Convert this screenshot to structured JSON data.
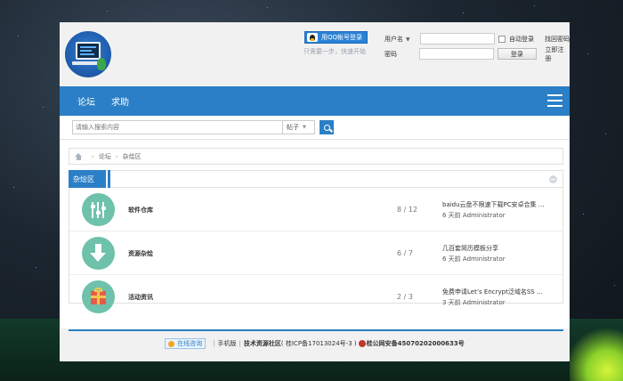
{
  "header": {
    "qq_login_label": "用QQ帐号登录",
    "qq_tip": "只需要一步，快速开始",
    "username_label": "用户名",
    "password_label": "密码",
    "auto_login_label": "自动登录",
    "find_password": "找回密码",
    "register": "立即注册",
    "login_button": "登录"
  },
  "nav": {
    "items": [
      "论坛",
      "求助"
    ]
  },
  "search": {
    "placeholder": "请输入搜索内容",
    "type": "帖子"
  },
  "breadcrumb": {
    "items": [
      "论坛",
      "杂烩区"
    ]
  },
  "board": {
    "title": "杂烩区",
    "forums": [
      {
        "name": "软件仓库",
        "count": "8 / 12",
        "last_title": "baidu云盘不限速下载PC安卓合集 ...",
        "last_meta": "6 天前 Administrator"
      },
      {
        "name": "资源杂烩",
        "count": "6 / 7",
        "last_title": "几百套简历模板分享",
        "last_meta": "6 天前 Administrator"
      },
      {
        "name": "活动资讯",
        "count": "2 / 3",
        "last_title": "免费申请Let’s Encrypt泛域名SS ...",
        "last_meta": "3 天前 Administrator"
      }
    ]
  },
  "footer": {
    "online_consult": "在线咨询",
    "mobile": "手机版",
    "site_name": "技术资源社区",
    "icp": "( 桂ICP备17013024号-3 )",
    "police": "桂公网安备45070202000633号"
  },
  "colors": {
    "brand_blue": "#2b7fc6",
    "forum_icon_bg": "#6ec1aa"
  }
}
